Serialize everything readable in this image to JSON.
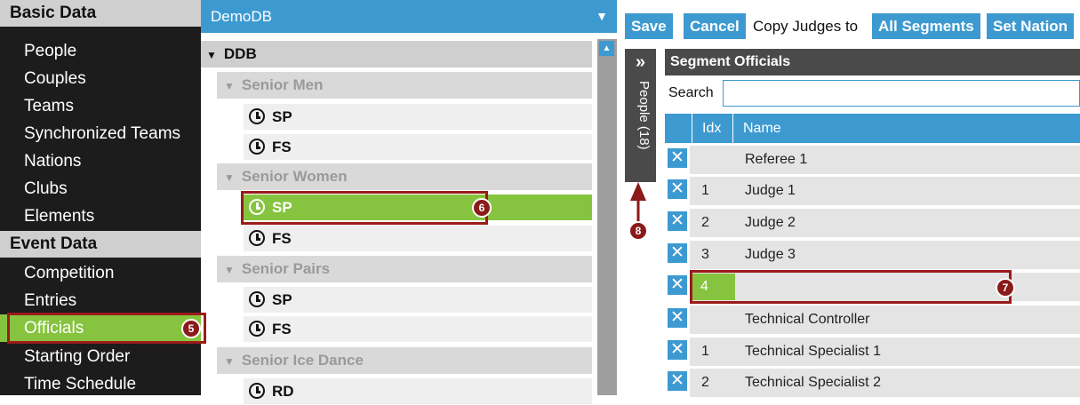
{
  "sidebar": {
    "sections": [
      {
        "title": "Basic Data",
        "items": [
          "People",
          "Couples",
          "Teams",
          "Synchronized Teams",
          "Nations",
          "Clubs",
          "Elements"
        ]
      },
      {
        "title": "Event Data",
        "items": [
          "Competition",
          "Entries",
          "Officials",
          "Starting Order",
          "Time Schedule"
        ]
      }
    ],
    "active_item": "Officials"
  },
  "tree": {
    "database": "DemoDB",
    "root": "DDB",
    "groups": [
      {
        "name": "Senior Men",
        "segments": [
          "SP",
          "FS"
        ]
      },
      {
        "name": "Senior Women",
        "segments": [
          "SP",
          "FS"
        ]
      },
      {
        "name": "Senior Pairs",
        "segments": [
          "SP",
          "FS"
        ]
      },
      {
        "name": "Senior Ice Dance",
        "segments": [
          "RD"
        ]
      }
    ]
  },
  "toolbar": {
    "save_label": "Save",
    "cancel_label": "Cancel",
    "copy_label": "Copy Judges to",
    "all_segments_label": "All Segments",
    "set_nation_label": "Set Nation"
  },
  "people_tab": {
    "label": "People (18)",
    "expand_icon": "»"
  },
  "segment_officials": {
    "title": "Segment Officials",
    "search_label": "Search",
    "search_value": "",
    "columns": {
      "idx": "Idx",
      "name": "Name"
    },
    "rows": [
      {
        "idx": "",
        "name": "Referee 1"
      },
      {
        "idx": "1",
        "name": "Judge 1"
      },
      {
        "idx": "2",
        "name": "Judge 2"
      },
      {
        "idx": "3",
        "name": "Judge 3"
      },
      {
        "idx": "4",
        "name": ""
      },
      {
        "idx": "",
        "name": "Technical Controller"
      },
      {
        "idx": "1",
        "name": "Technical Specialist 1"
      },
      {
        "idx": "2",
        "name": "Technical Specialist 2"
      }
    ],
    "remove_icon": "close-icon"
  },
  "callouts": [
    "5",
    "6",
    "7",
    "8"
  ],
  "colors": {
    "accent": "#3d9ad1",
    "active": "#86c43f",
    "callout": "#9b1b1b",
    "sidebar_bg": "#1c1c1c"
  }
}
